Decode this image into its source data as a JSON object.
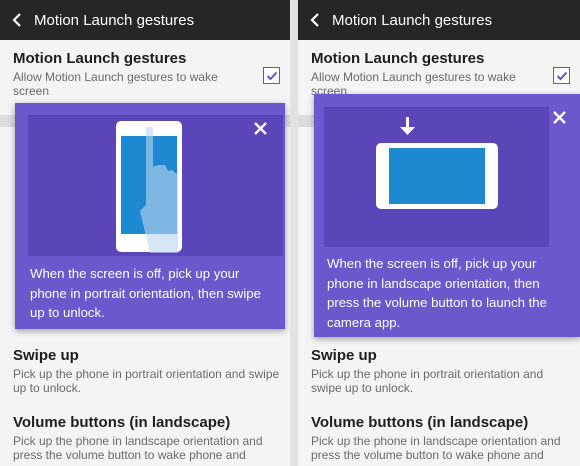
{
  "left": {
    "title": "Motion Launch gestures",
    "setting_title": "Motion Launch gestures",
    "setting_sub": "Allow Motion Launch gestures to wake screen",
    "tip": "When the screen is off, pick up your phone in portrait orientation, then swipe up to unlock.",
    "swipe_title": "Swipe up",
    "swipe_sub": "Pick up the phone in portrait orientation and swipe up to unlock.",
    "volume_title": "Volume buttons (in landscape)",
    "volume_sub": "Pick up the phone in landscape orientation and press the volume button to wake phone and"
  },
  "right": {
    "title": "Motion Launch gestures",
    "setting_title": "Motion Launch gestures",
    "setting_sub": "Allow Motion Launch gestures to wake screen",
    "tip": "When the screen is off, pick up your phone in landscape orientation, then press the volume button to launch the camera app.",
    "swipe_title": "Swipe up",
    "swipe_sub": "Pick up the phone in portrait orientation and swipe up to unlock.",
    "volume_title": "Volume buttons (in landscape)",
    "volume_sub": "Pick up the phone in landscape orientation and press the volume button to wake phone and"
  },
  "icons": {
    "back": "back-arrow-icon",
    "close": "close-icon",
    "check": "check-icon",
    "hand": "hand-icon",
    "arrow": "down-arrow-icon"
  },
  "colors": {
    "appbar": "#262626",
    "accent": "#6753c8",
    "card": "#6a58cc",
    "card_inner": "#5a46b8",
    "phone_screen": "#1e88d0"
  }
}
